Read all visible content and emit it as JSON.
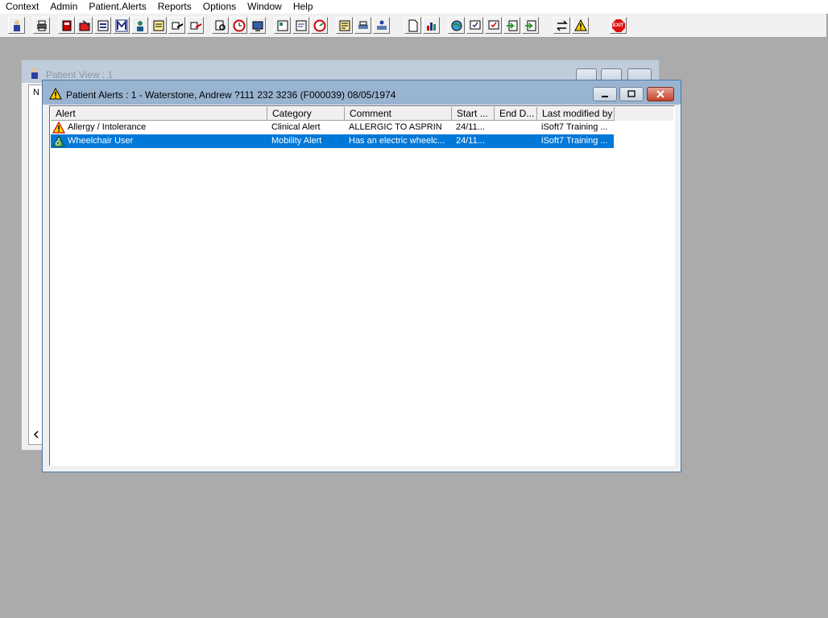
{
  "menu": {
    "items": [
      "Context",
      "Admin",
      "Patient.Alerts",
      "Reports",
      "Options",
      "Window",
      "Help"
    ]
  },
  "toolbar": {
    "icons": [
      "patient-icon",
      "print-icon",
      "book-icon",
      "folder-edit-icon",
      "list-icon",
      "letter-m-icon",
      "person-icon",
      "note-icon",
      "hand-pointer-icon",
      "hand-pointer-icon",
      "magnify-doc-icon",
      "clock-icon",
      "monitor-icon",
      "doc-card-icon",
      "doc-card-icon",
      "gauge-icon",
      "notepad-icon",
      "printer-icon",
      "printer-person-icon",
      "page-icon",
      "bar-chart-icon",
      "globe-icon",
      "check-doc-icon",
      "check-doc-icon",
      "arrows-doc-icon",
      "arrows-doc-icon",
      "swap-arrows-icon",
      "warning-icon",
      "exit-icon"
    ],
    "exit_label": "EXIT"
  },
  "back_window": {
    "title": "Patient View : 1",
    "partial_header": "N"
  },
  "main_window": {
    "title": "Patient Alerts : 1 - Waterstone, Andrew ?111 232 3236 (F000039) 08/05/1974"
  },
  "table": {
    "columns": [
      "Alert",
      "Category",
      "Comment",
      "Start ...",
      "End D...",
      "Last modified by"
    ],
    "rows": [
      {
        "icon": "warning-icon",
        "alert": "Allergy / Intolerance",
        "category": "Clinical Alert",
        "comment": "ALLERGIC TO ASPRIN",
        "start": "24/11...",
        "end": "",
        "modified_by": "iSoft7 Training ..."
      },
      {
        "icon": "wheelchair-icon",
        "alert": "Wheelchair User",
        "category": "Mobility Alert",
        "comment": "Has an electric wheelc...",
        "start": "24/11...",
        "end": "",
        "modified_by": "iSoft7 Training ..."
      }
    ],
    "selected_row": 1
  },
  "colors": {
    "desktop": "#ababab",
    "title_active": "#99b4d1",
    "title_inactive": "#bfcddb",
    "selection": "#0078d7"
  }
}
